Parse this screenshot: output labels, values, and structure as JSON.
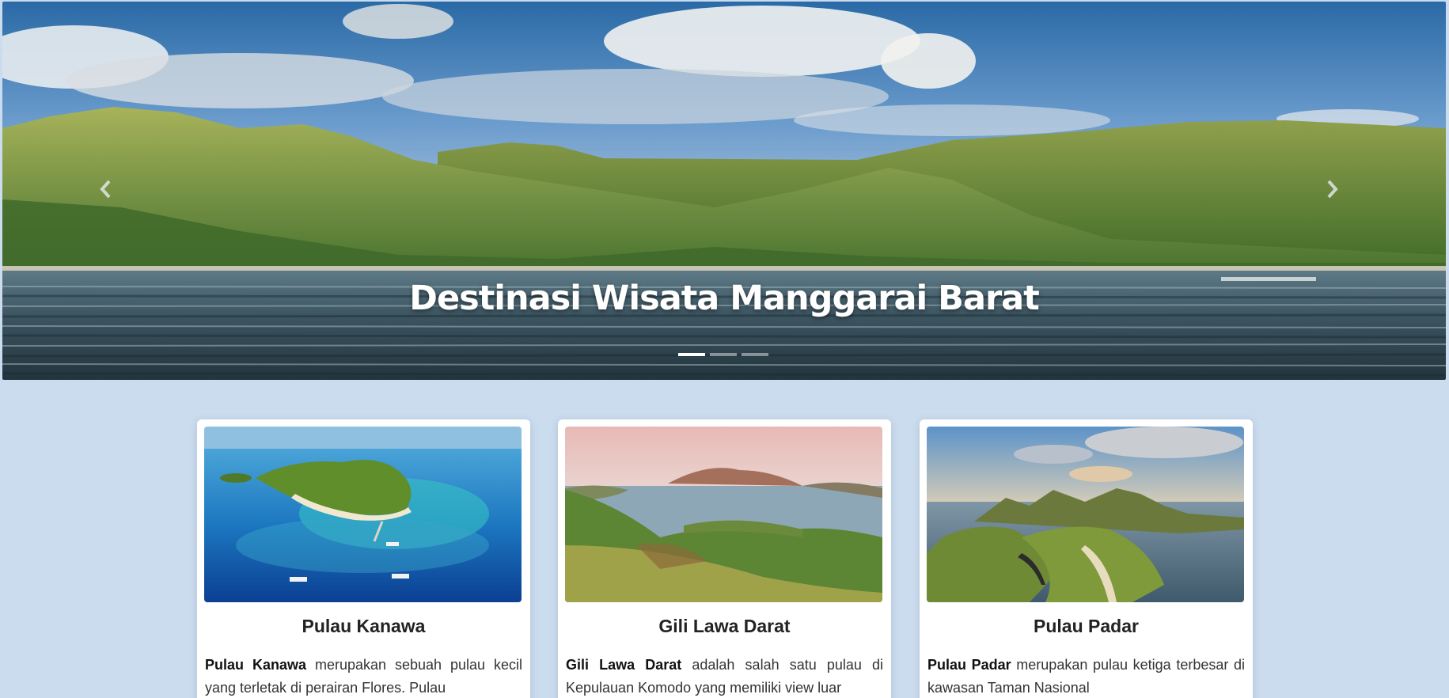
{
  "hero": {
    "title": "Destinasi Wisata Manggarai Barat",
    "prev_icon": "chevron-left-icon",
    "next_icon": "chevron-right-icon",
    "slide_count": 3,
    "active_slide": 1
  },
  "cards": [
    {
      "title": "Pulau Kanawa",
      "bold": "Pulau Kanawa",
      "text": " merupakan sebuah pulau kecil yang terletak di perairan Flores. Pulau"
    },
    {
      "title": "Gili Lawa Darat",
      "bold": "Gili Lawa Darat",
      "text": " adalah salah satu pulau di Kepulauan Komodo yang memiliki view luar"
    },
    {
      "title": "Pulau Padar",
      "bold": "Pulau Padar",
      "text": " merupakan pulau ketiga terbesar di kawasan Taman Nasional"
    }
  ],
  "colors": {
    "page_background": "#cbdcee",
    "card_background": "#ffffff",
    "title_text": "#ffffff"
  }
}
